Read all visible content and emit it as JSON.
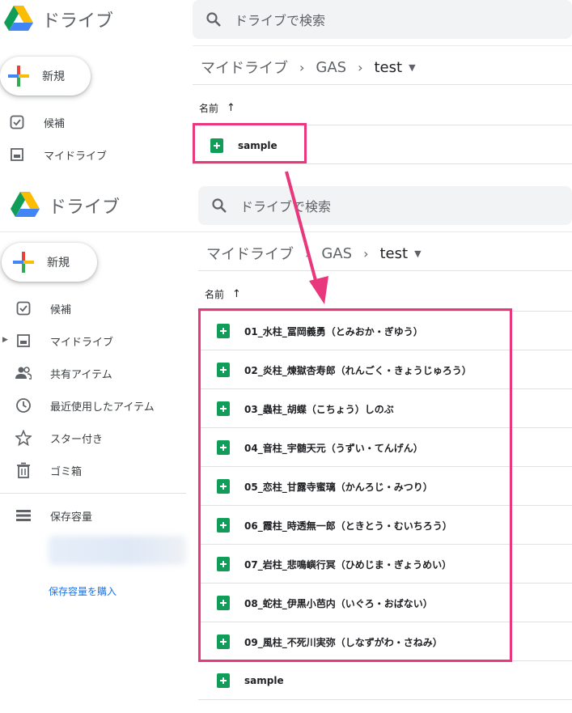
{
  "colors": {
    "accent": "#e8377d",
    "link": "#1a73e8",
    "sheets": "#0f9d58"
  },
  "top": {
    "brand": "ドライブ",
    "search_placeholder": "ドライブで検索",
    "new_label": "新規",
    "nav": [
      "候補",
      "マイドライブ"
    ],
    "breadcrumb": [
      "マイドライブ",
      "GAS",
      "test"
    ],
    "column_name": "名前",
    "files": [
      "sample"
    ]
  },
  "bottom": {
    "brand": "ドライブ",
    "search_placeholder": "ドライブで検索",
    "new_label": "新規",
    "nav": [
      "候補",
      "マイドライブ",
      "共有アイテム",
      "最近使用したアイテム",
      "スター付き",
      "ゴミ箱"
    ],
    "storage_label": "保存容量",
    "buy_storage": "保存容量を購入",
    "breadcrumb": [
      "マイドライブ",
      "GAS",
      "test"
    ],
    "column_name": "名前",
    "files": [
      "01_水柱_冨岡義勇（とみおか・ぎゆう）",
      "02_炎柱_煉獄杏寿郎（れんごく・きょうじゅろう）",
      "03_蟲柱_胡蝶（こちょう）しのぶ",
      "04_音柱_宇髄天元（うずい・てんげん）",
      "05_恋柱_甘露寺蜜璃（かんろじ・みつり）",
      "06_霞柱_時透無一郎（ときとう・むいちろう）",
      "07_岩柱_悲鳴嶼行冥（ひめじま・ぎょうめい）",
      "08_蛇柱_伊黒小芭内（いぐろ・おばない）",
      "09_風柱_不死川実弥（しなずがわ・さねみ）",
      "sample"
    ]
  }
}
